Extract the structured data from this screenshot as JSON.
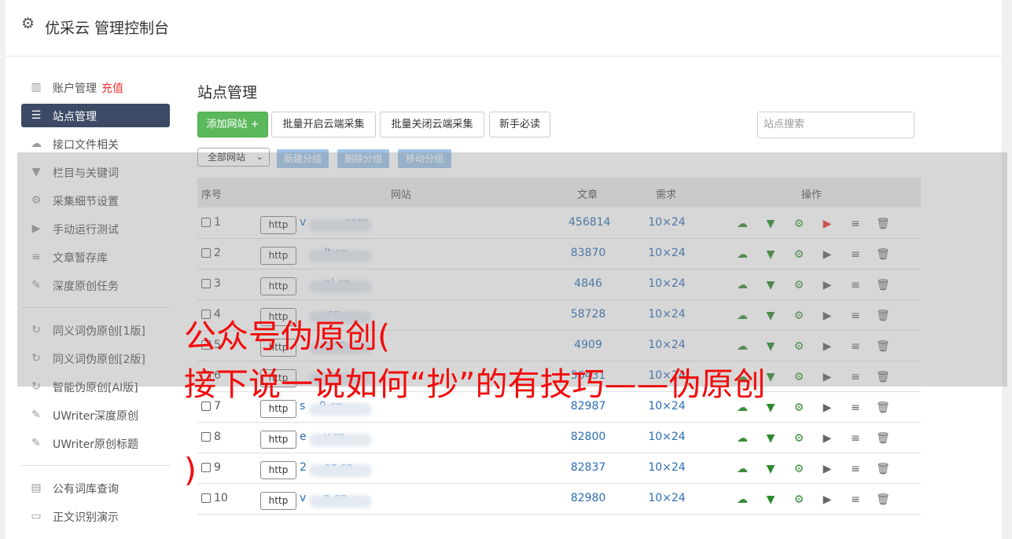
{
  "header": {
    "title": "优采云 管理控制台",
    "icon": "gear-icon"
  },
  "sidebar": {
    "items": [
      {
        "label": "账户管理",
        "extra": "充值",
        "icon": "bar-chart-icon"
      },
      {
        "label": "站点管理",
        "icon": "server-icon",
        "active": true
      },
      {
        "label": "接口文件相关",
        "icon": "cloud-upload-icon"
      },
      {
        "label": "栏目与关键词",
        "icon": "filter-icon"
      },
      {
        "label": "采集细节设置",
        "icon": "cogs-icon"
      },
      {
        "label": "手动运行测试",
        "icon": "play-icon"
      },
      {
        "label": "文章暂存库",
        "icon": "database-icon"
      },
      {
        "label": "深度原创任务",
        "icon": "edit-icon"
      },
      {
        "label": "同义词伪原创[1版]",
        "icon": "refresh-icon"
      },
      {
        "label": "同义词伪原创[2版]",
        "icon": "refresh-icon"
      },
      {
        "label": "智能伪原创[AI版]",
        "icon": "refresh-icon"
      },
      {
        "label": "UWriter深度原创",
        "icon": "edit-icon"
      },
      {
        "label": "UWriter原创标题",
        "icon": "edit-icon"
      },
      {
        "label": "公有词库查询",
        "icon": "book-icon"
      },
      {
        "label": "正文识别演示",
        "icon": "monitor-icon"
      }
    ]
  },
  "main": {
    "title": "站点管理",
    "toolbar": {
      "add_site": "添加网站 +",
      "batch_open": "批量开启云端采集",
      "batch_close": "批量关闭云端采集",
      "newbie": "新手必读",
      "search_placeholder": "站点搜索"
    },
    "group_bar": {
      "select_value": "全部网站",
      "new_group": "新建分组",
      "delete_group": "删除分组",
      "move_group": "移动分组"
    },
    "table": {
      "headers": {
        "index": "序号",
        "site": "网站",
        "articles": "文章",
        "demand": "需求",
        "actions": "操作"
      },
      "rows": [
        {
          "num": "1",
          "http": "http",
          "site": "v          .com",
          "articles": "456814",
          "demand": "10×24"
        },
        {
          "num": "2",
          "http": "http",
          "site": "       lt.cn",
          "articles": "83870",
          "demand": "10×24"
        },
        {
          "num": "3",
          "http": "http",
          "site": "       ni.cn",
          "articles": "4846",
          "demand": "10×24"
        },
        {
          "num": "4",
          "http": "http",
          "site": "       .cn",
          "articles": "58728",
          "demand": "10×24"
        },
        {
          "num": "5",
          "http": "http",
          "site": "       s.cn",
          "articles": "4909",
          "demand": "10×24"
        },
        {
          "num": "6",
          "http": "http",
          "site": "       .cn",
          "articles": "56431",
          "demand": "10×24"
        },
        {
          "num": "7",
          "http": "http",
          "site": "s    9.cn",
          "articles": "82987",
          "demand": "10×24"
        },
        {
          "num": "8",
          "http": "http",
          "site": "e     y.cn",
          "articles": "82800",
          "demand": "10×24"
        },
        {
          "num": "9",
          "http": "http",
          "site": "2     az.cn",
          "articles": "82837",
          "demand": "10×24"
        },
        {
          "num": "10",
          "http": "http",
          "site": "v     p.cn",
          "articles": "82980",
          "demand": "10×24"
        }
      ]
    }
  },
  "watermark": {
    "line1": "公众号伪原创(",
    "line2": "接下说一说如何“抄”的有技巧——伪原创",
    "line3": ")"
  },
  "colors": {
    "accent_green": "#5cb85c",
    "sidebar_active": "#3c4a66",
    "link_blue": "#2a6db5",
    "watermark_red": "#f20c0c"
  }
}
